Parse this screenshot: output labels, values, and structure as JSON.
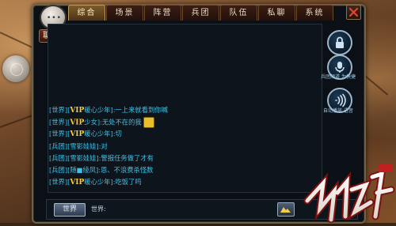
{
  "tabs": [
    {
      "label": "综合",
      "active": true
    },
    {
      "label": "场景",
      "active": false
    },
    {
      "label": "阵营",
      "active": false
    },
    {
      "label": "兵团",
      "active": false
    },
    {
      "label": "队伍",
      "active": false
    },
    {
      "label": "私聊",
      "active": false
    },
    {
      "label": "系统",
      "active": false
    }
  ],
  "chat_badge": {
    "label": "聊天",
    "icon": "speech-bubble-icon"
  },
  "messages": [
    {
      "channel": "[世界][",
      "vip": "VIP",
      "text": "暖心少年]:一上来就看到你喊"
    },
    {
      "channel": "[世界][",
      "vip": "VIP",
      "text": "少女]:无处不在的我",
      "emoji": true
    },
    {
      "channel": "[世界][",
      "vip": "VIP",
      "text": "暖心少年]:切"
    },
    {
      "channel": "[兵团][",
      "vip": "",
      "text": "雪影娃娃]:对"
    },
    {
      "channel": "[兵团][",
      "vip": "",
      "text": "雪影娃娃]:警报任务做了才有"
    },
    {
      "channel": "[兵团][",
      "vip": "",
      "text": "随■绫凤]:恩、不浪费杀怪数"
    },
    {
      "channel": "[世界][",
      "vip": "VIP",
      "text": "暖心少年]:吃饭了吗"
    }
  ],
  "side_buttons": [
    {
      "name": "lock",
      "label": ""
    },
    {
      "name": "mic",
      "label": "兵团频道 为快捷"
    },
    {
      "name": "voice",
      "label": "自动播放 语音"
    }
  ],
  "bottom": {
    "world_button": "世界",
    "world_label": "世界:",
    "input_value": ""
  },
  "colors": {
    "channel_text": "#3ec1e6",
    "vip": "#ffcc33",
    "panel_bg": "#0a1016"
  }
}
